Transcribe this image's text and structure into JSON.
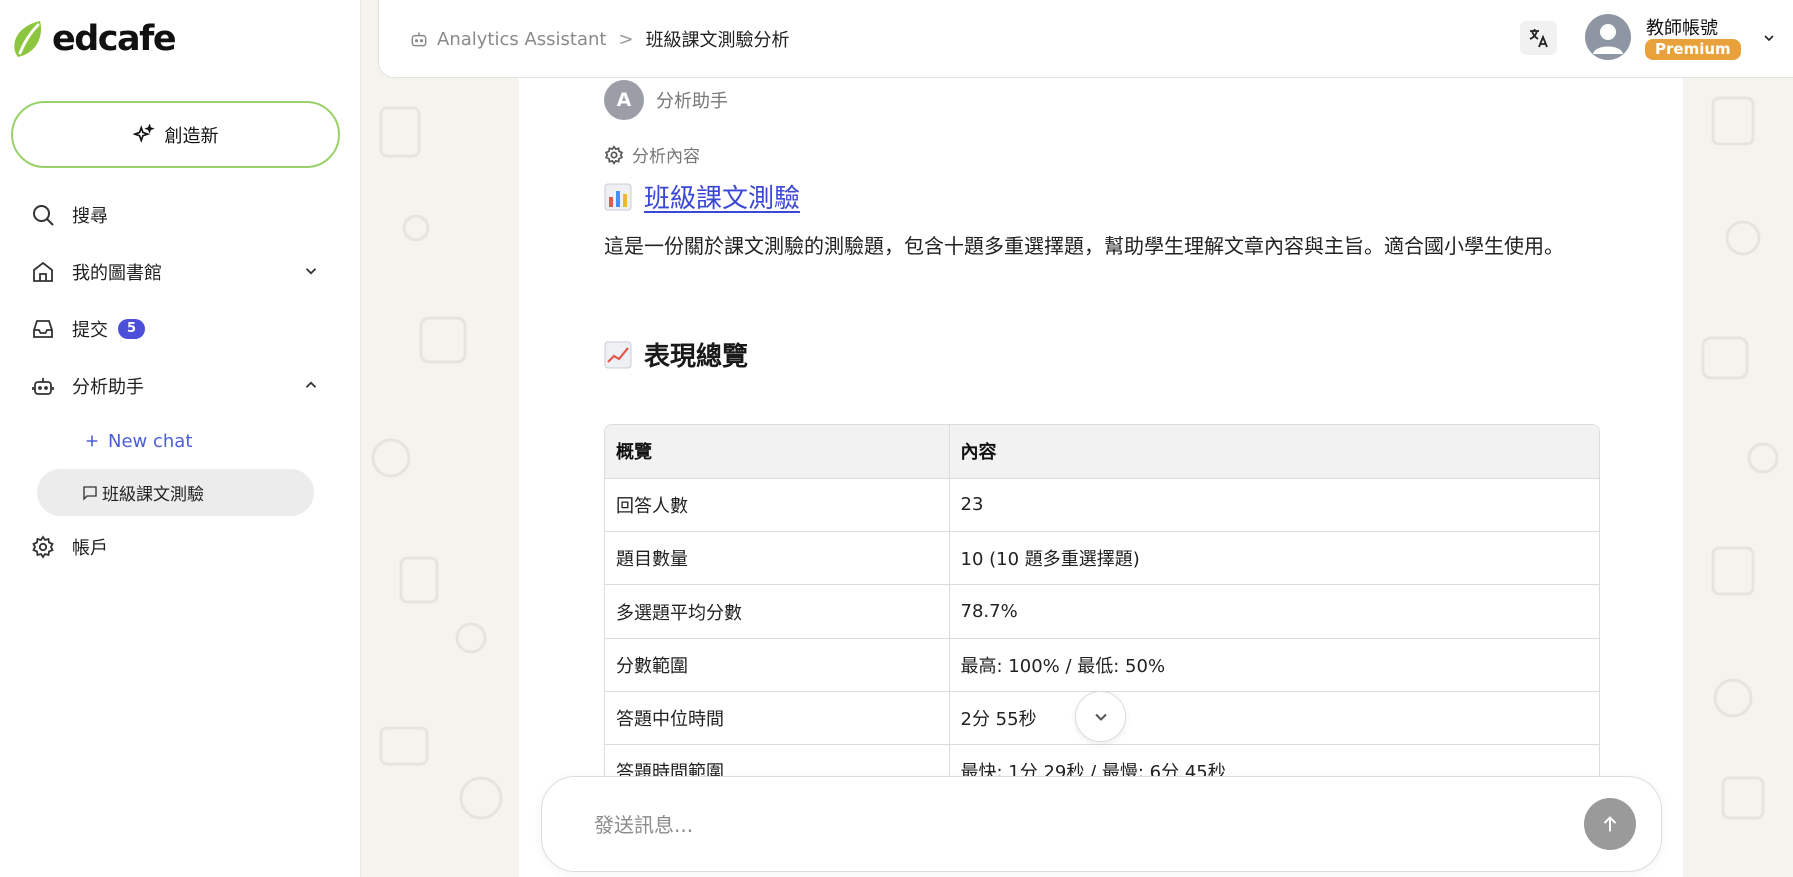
{
  "brand": {
    "name": "edcafe",
    "leaf_color": "#8cc63f"
  },
  "sidebar": {
    "create_label": "創造新",
    "items": [
      {
        "label": "搜尋",
        "icon": "search-icon"
      },
      {
        "label": "我的圖書館",
        "icon": "home-icon"
      },
      {
        "label": "提交",
        "icon": "inbox-icon",
        "badge": "5"
      },
      {
        "label": "分析助手",
        "icon": "bot-icon"
      },
      {
        "label": "帳戶",
        "icon": "gear-icon"
      }
    ],
    "new_chat_label": "New chat",
    "chats": [
      {
        "label": "班級課文測驗"
      }
    ]
  },
  "header": {
    "breadcrumb_root": "Analytics Assistant",
    "breadcrumb_sep": ">",
    "breadcrumb_current": "班級課文測驗分析",
    "user_name": "教師帳號",
    "plan": "Premium"
  },
  "chat": {
    "assistant_initial": "A",
    "assistant_name": "分析助手",
    "content_label": "分析內容",
    "quiz_title": "班級課文測驗",
    "description": "這是一份關於課文測驗的測驗題，包含十題多重選擇題，幫助學生理解文章內容與主旨。適合國小學生使用。",
    "section_title": "表現總覽",
    "table": {
      "headers": [
        "概覽",
        "內容"
      ],
      "rows": [
        [
          "回答人數",
          "23"
        ],
        [
          "題目數量",
          "10 (10 題多重選擇題)"
        ],
        [
          "多選題平均分數",
          "78.7%"
        ],
        [
          "分數範圍",
          "最高: 100% / 最低: 50%"
        ],
        [
          "答題中位時間",
          "2分 55秒"
        ],
        [
          "答題時間範圍",
          "最快: 1分 29秒 / 最慢: 6分 45秒"
        ]
      ]
    }
  },
  "composer": {
    "placeholder": "發送訊息..."
  },
  "colors": {
    "accent": "#4b4fd9",
    "create_border": "#9ad16a",
    "premium": "#e9a23b",
    "link": "#3b47d6"
  }
}
